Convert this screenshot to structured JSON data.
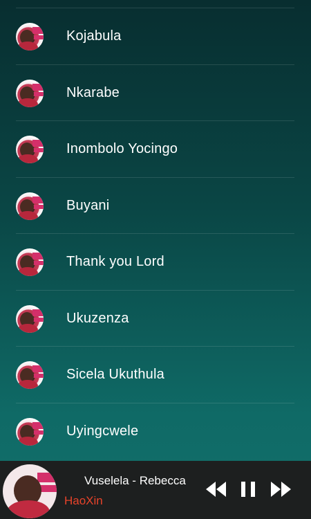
{
  "tracks": [
    {
      "title": "Kojabula"
    },
    {
      "title": "Nkarabe"
    },
    {
      "title": "Inombolo Yocingo"
    },
    {
      "title": "Buyani"
    },
    {
      "title": "Thank you Lord"
    },
    {
      "title": "Ukuzenza"
    },
    {
      "title": "Sicela Ukuthula"
    },
    {
      "title": "Uyingcwele"
    }
  ],
  "player": {
    "title": "Vuselela - Rebecca",
    "artist": "HaoXin",
    "accent_color": "#e8432a",
    "controls": [
      "rewind-icon",
      "pause-icon",
      "fast-forward-icon"
    ]
  }
}
